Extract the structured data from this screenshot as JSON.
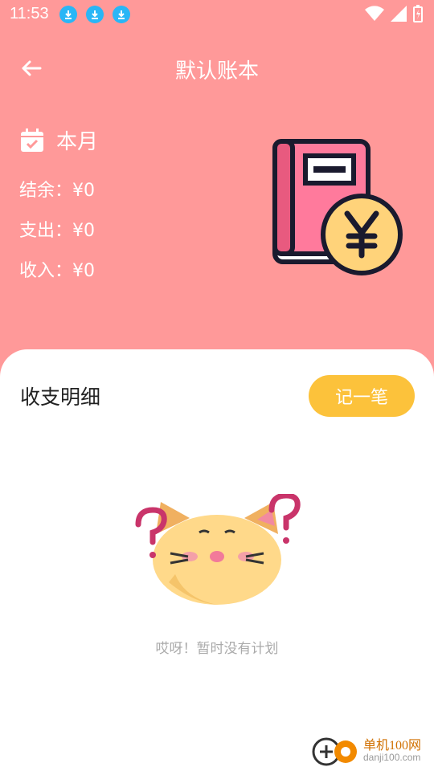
{
  "status_bar": {
    "time": "11:53",
    "download_icons": [
      "download-icon",
      "download-icon",
      "download-icon"
    ]
  },
  "header": {
    "back_icon": "arrow-left-icon",
    "title": "默认账本"
  },
  "summary": {
    "calendar_icon": "calendar-check-icon",
    "period": "本月",
    "balance": "结余：¥0",
    "expense": "支出：¥0",
    "income": "收入：¥0"
  },
  "details": {
    "title": "收支明细",
    "add_button": "记一笔",
    "empty_text": "哎呀！暂时没有计划"
  },
  "watermark": {
    "name": "单机100网",
    "url": "danji100.com"
  },
  "colors": {
    "header_bg": "#ff9999",
    "accent": "#fcc23b",
    "panel_bg": "#ffffff"
  }
}
